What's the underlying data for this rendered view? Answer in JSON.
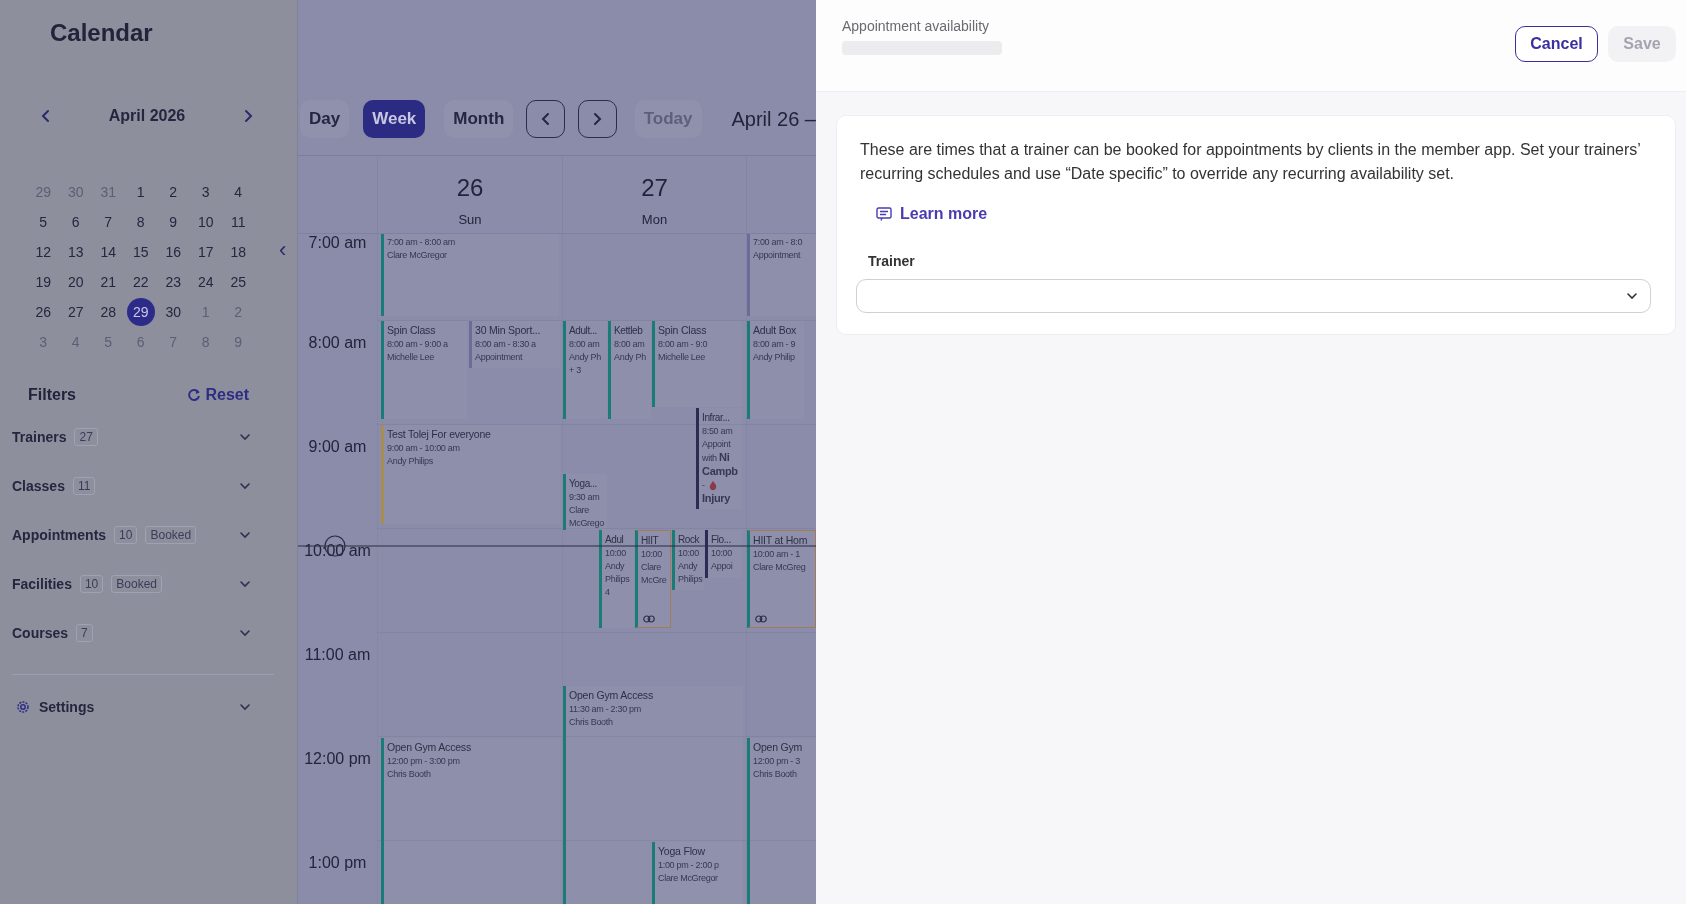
{
  "sidebar": {
    "title": "Calendar",
    "collapse_icon": "‹",
    "mini_calendar": {
      "month": "April 2026",
      "days": [
        {
          "label": "29",
          "outside": true,
          "selected": false
        },
        {
          "label": "30",
          "outside": true,
          "selected": false
        },
        {
          "label": "31",
          "outside": true,
          "selected": false
        },
        {
          "label": "1",
          "outside": false,
          "selected": false
        },
        {
          "label": "2",
          "outside": false,
          "selected": false
        },
        {
          "label": "3",
          "outside": false,
          "selected": false
        },
        {
          "label": "4",
          "outside": false,
          "selected": false
        },
        {
          "label": "5",
          "outside": false,
          "selected": false
        },
        {
          "label": "6",
          "outside": false,
          "selected": false
        },
        {
          "label": "7",
          "outside": false,
          "selected": false
        },
        {
          "label": "8",
          "outside": false,
          "selected": false
        },
        {
          "label": "9",
          "outside": false,
          "selected": false
        },
        {
          "label": "10",
          "outside": false,
          "selected": false
        },
        {
          "label": "11",
          "outside": false,
          "selected": false
        },
        {
          "label": "12",
          "outside": false,
          "selected": false
        },
        {
          "label": "13",
          "outside": false,
          "selected": false
        },
        {
          "label": "14",
          "outside": false,
          "selected": false
        },
        {
          "label": "15",
          "outside": false,
          "selected": false
        },
        {
          "label": "16",
          "outside": false,
          "selected": false
        },
        {
          "label": "17",
          "outside": false,
          "selected": false
        },
        {
          "label": "18",
          "outside": false,
          "selected": false
        },
        {
          "label": "19",
          "outside": false,
          "selected": false
        },
        {
          "label": "20",
          "outside": false,
          "selected": false
        },
        {
          "label": "21",
          "outside": false,
          "selected": false
        },
        {
          "label": "22",
          "outside": false,
          "selected": false
        },
        {
          "label": "23",
          "outside": false,
          "selected": false
        },
        {
          "label": "24",
          "outside": false,
          "selected": false
        },
        {
          "label": "25",
          "outside": false,
          "selected": false
        },
        {
          "label": "26",
          "outside": false,
          "selected": false
        },
        {
          "label": "27",
          "outside": false,
          "selected": false
        },
        {
          "label": "28",
          "outside": false,
          "selected": false
        },
        {
          "label": "29",
          "outside": false,
          "selected": true
        },
        {
          "label": "30",
          "outside": false,
          "selected": false
        },
        {
          "label": "1",
          "outside": true,
          "selected": false
        },
        {
          "label": "2",
          "outside": true,
          "selected": false
        },
        {
          "label": "3",
          "outside": true,
          "selected": false
        },
        {
          "label": "4",
          "outside": true,
          "selected": false
        },
        {
          "label": "5",
          "outside": true,
          "selected": false
        },
        {
          "label": "6",
          "outside": true,
          "selected": false
        },
        {
          "label": "7",
          "outside": true,
          "selected": false
        },
        {
          "label": "8",
          "outside": true,
          "selected": false
        },
        {
          "label": "9",
          "outside": true,
          "selected": false
        }
      ]
    },
    "filters": {
      "title": "Filters",
      "reset": "Reset",
      "items": [
        {
          "label": "Trainers",
          "count": "27"
        },
        {
          "label": "Classes",
          "count": "11"
        },
        {
          "label": "Appointments",
          "count": "10",
          "tag": "Booked"
        },
        {
          "label": "Facilities",
          "count": "10",
          "tag": "Booked"
        },
        {
          "label": "Courses",
          "count": "7"
        }
      ]
    },
    "settings": {
      "label": "Settings"
    }
  },
  "toolbar": {
    "views": [
      {
        "label": "Day",
        "selected": false
      },
      {
        "label": "Week",
        "selected": true
      },
      {
        "label": "Month",
        "selected": false
      }
    ],
    "today": {
      "label": "Today",
      "disabled": true
    },
    "range": "April 26 –"
  },
  "week": {
    "days": [
      {
        "number": "26",
        "name": "Sun"
      },
      {
        "number": "27",
        "name": "Mon"
      }
    ],
    "times": [
      "7:00 am",
      "8:00 am",
      "9:00 am",
      "10:00 am",
      "11:00 am",
      "12:00 pm",
      "1:00 pm"
    ],
    "events": [
      {
        "lines": [
          "7:00 am - 8:00 am",
          "Clare McGregor"
        ],
        "color": "#1b7b77",
        "linked": false,
        "flagged": false
      },
      {
        "title": "Spin Class",
        "lines": [
          "8:00 am - 9:00 a",
          "Michelle Lee"
        ],
        "color": "#1b7b77",
        "linked": false,
        "flagged": false
      },
      {
        "title": "30 Min Sport...",
        "lines": [
          "8:00 am - 8:30 a",
          "Appointment"
        ],
        "color": "#6e6b98",
        "linked": false,
        "flagged": false
      },
      {
        "title": "Test Tolej For everyone",
        "lines": [
          "9:00 am - 10:00 am",
          "Andy Philips"
        ],
        "color": "#a98e52",
        "linked": false,
        "flagged": false
      },
      {
        "title": "Open Gym Access",
        "lines": [
          "12:00 pm - 3:00 pm",
          "Chris Booth"
        ],
        "color": "#1b7b77",
        "linked": false,
        "flagged": false
      },
      {
        "title": "Adult...",
        "lines": [
          "8:00 am",
          "Andy Ph",
          "+ 3"
        ],
        "color": "#1b7b77",
        "linked": false,
        "flagged": false
      },
      {
        "title": "Kettleb",
        "lines": [
          "8:00 am",
          "Andy Ph"
        ],
        "color": "#1b7b77",
        "linked": false,
        "flagged": false
      },
      {
        "title": "Spin Class",
        "lines": [
          "8:00 am - 9:0",
          "Michelle Lee"
        ],
        "color": "#1b7b77",
        "linked": false,
        "flagged": false
      },
      {
        "title": "Infrar...",
        "lines": [
          "8:50 am",
          "Appoint",
          "with **Ni**",
          "**Campb**",
          "-",
          "**Injury**"
        ],
        "color": "#2a2c52",
        "linked": false,
        "flagged": true
      },
      {
        "title": "Yoga...",
        "lines": [
          "9:30 am",
          "Clare",
          "McGrego"
        ],
        "color": "#1b7b77",
        "linked": false,
        "flagged": false
      },
      {
        "title": "Adul",
        "lines": [
          "10:00",
          "Andy",
          "Philips",
          "4"
        ],
        "color": "#1b7b77",
        "linked": false,
        "flagged": false
      },
      {
        "title": "HIIT",
        "lines": [
          "10:00",
          "Clare",
          "McGre"
        ],
        "color": "#1b7b77",
        "linked": true,
        "flagged": false
      },
      {
        "title": "Rock",
        "lines": [
          "10:00",
          "Andy",
          "Philips"
        ],
        "color": "#1b7b77",
        "linked": false,
        "flagged": false
      },
      {
        "title": "Flo...",
        "lines": [
          "10:00",
          "Appoi"
        ],
        "color": "#2a2c52",
        "linked": false,
        "flagged": false
      },
      {
        "lines": [
          "7:00 am - 8:0",
          "Appointment"
        ],
        "color": "#6e6b98",
        "linked": false,
        "flagged": false
      },
      {
        "title": "Adult Box",
        "lines": [
          "8:00 am - 9",
          "Andy Philip"
        ],
        "color": "#1b7b77",
        "linked": false,
        "flagged": false
      },
      {
        "title": "HIIT at Hom",
        "lines": [
          "10:00 am - 1",
          "Clare McGreg"
        ],
        "color": "#1b7b77",
        "linked": true,
        "flagged": false
      },
      {
        "title": "Open Gym",
        "lines": [
          "12:00 pm - 3",
          "Chris Booth"
        ],
        "color": "#1b7b77",
        "linked": false,
        "flagged": false
      },
      {
        "title": "Open Gym Access",
        "lines": [
          "11:30 am - 2:30 pm",
          "Chris Booth"
        ],
        "color": "#1b7b77",
        "linked": false,
        "flagged": false
      },
      {
        "title": "Yoga Flow",
        "lines": [
          "1:00 pm - 2:00 p",
          "Clare McGregor"
        ],
        "color": "#1b7b77",
        "linked": false,
        "flagged": false
      }
    ]
  },
  "panel": {
    "title": "Appointment availability",
    "cancel": "Cancel",
    "save": {
      "label": "Save",
      "disabled": true
    },
    "description": "These are times that a trainer can be booked for appointments by clients in the member app. Set your trainers’ recurring schedules and use “Date specific” to override any recurring availability set.",
    "learn_more": "Learn more",
    "trainer": {
      "label": "Trainer"
    }
  }
}
